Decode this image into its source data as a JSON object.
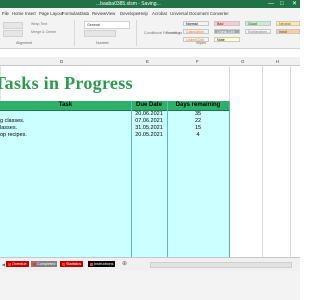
{
  "window": {
    "title": "...baaba0385.xlsm - Saving..."
  },
  "menu": [
    "File",
    "Home",
    "Insert",
    "Page Layout",
    "Formulas",
    "Data",
    "Review",
    "View",
    "Developer",
    "Help",
    "Acrobat",
    "Universal Document Converter"
  ],
  "ribbon": {
    "groups": [
      "Alignment",
      "Number",
      "Styles"
    ],
    "wrap_text": "Wrap Text",
    "merge_center": "Merge & Center",
    "number_format": "General",
    "conditional_formatting": "Conditional Formatting",
    "format_as_table": "Format as Table",
    "styles": [
      {
        "label": "Normal",
        "bg": "#ffffff"
      },
      {
        "label": "Bad",
        "bg": "#ffc7ce"
      },
      {
        "label": "Good",
        "bg": "#c6efce"
      },
      {
        "label": "Neutral",
        "bg": "#ffeb9c"
      },
      {
        "label": "Calculation",
        "bg": "#f2f2f2"
      },
      {
        "label": "Check Cell",
        "bg": "#a5a5a5"
      },
      {
        "label": "Explanatory...",
        "bg": "#ffffff"
      },
      {
        "label": "Input",
        "bg": "#ffcc99"
      },
      {
        "label": "Linked Cell",
        "bg": "#ffffff"
      },
      {
        "label": "Note",
        "bg": "#ffffcc"
      }
    ]
  },
  "columns": [
    "D",
    "E",
    "F",
    "G",
    "H"
  ],
  "sheet_title": "Tasks in Progress",
  "table": {
    "headers": [
      "Task",
      "Due Date",
      "Days remaining"
    ],
    "rows": [
      {
        "task": "",
        "due": "20.06.2021",
        "days": "35"
      },
      {
        "task": "g classes.",
        "due": "07.06.2021",
        "days": "22"
      },
      {
        "task": "lasses.",
        "due": "31.05.2021",
        "days": "15"
      },
      {
        "task": "op recipes.",
        "due": "20.05.2021",
        "days": "4"
      }
    ]
  },
  "sheet_tabs": [
    {
      "label": "Overdue",
      "bg": "#c00000"
    },
    {
      "label": "Completed",
      "bg": "#7f7f7f"
    },
    {
      "label": "Statistics",
      "bg": "#c00000"
    },
    {
      "label": "Instructions",
      "bg": "#000000"
    }
  ],
  "colors": {
    "accent": "#217346",
    "title": "#2e9a4e",
    "table_header": "#2db06a",
    "table_body": "#ccffff"
  }
}
